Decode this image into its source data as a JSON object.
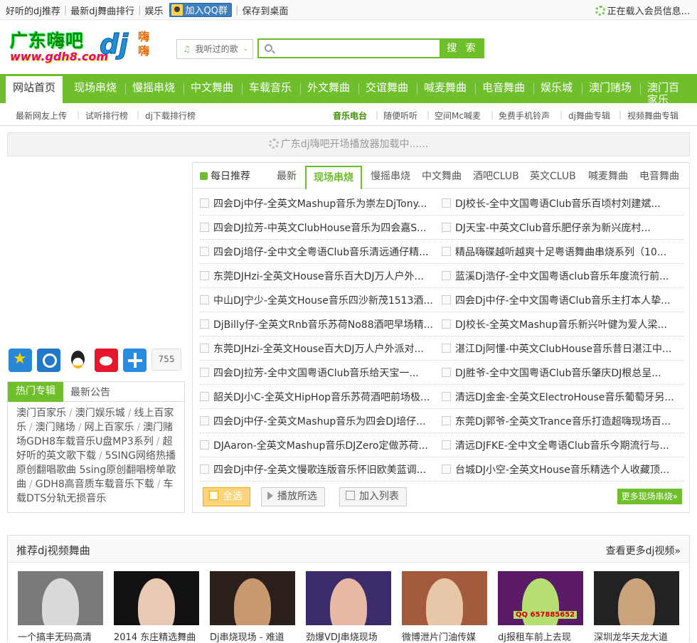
{
  "topbar": {
    "links": [
      "好听的dj推荐",
      "最新dj舞曲排行",
      "娱乐"
    ],
    "qq_group": "加入QQ群",
    "save_desktop": "保存到桌面",
    "member_loading": "正在载入会员信息..."
  },
  "logo": {
    "title": "广东嗨吧",
    "url": "www.gdh8.com",
    "dj": "dj",
    "hihi": "嗨嗨"
  },
  "search": {
    "history_label": "我听过的歌",
    "button_label": "搜 索",
    "value": ""
  },
  "nav": {
    "items": [
      "网站首页",
      "现场串烧",
      "慢摇串烧",
      "中文舞曲",
      "车载音乐",
      "外文舞曲",
      "交谊舞曲",
      "喊麦舞曲",
      "电音舞曲",
      "娱乐城",
      "澳门赌场",
      "澳门百家乐"
    ]
  },
  "subnav": {
    "left": [
      "最新网友上传",
      "试听排行榜",
      "dj下载排行榜"
    ],
    "right": [
      "音乐电台",
      "随便听听",
      "空间Mc喊麦",
      "免费手机铃声",
      "dj舞曲专辑",
      "视频舞曲专辑"
    ]
  },
  "player_loading": "广东dj嗨吧开场播放器加载中......",
  "share": {
    "count": "755",
    "icons": [
      "qzone-star-icon",
      "tencent-weibo-icon",
      "qq-icon",
      "sina-weibo-icon",
      "more-share-icon"
    ]
  },
  "hot_albums": {
    "tab_active": "热门专辑",
    "tab_other": "最新公告",
    "items": [
      "澳门百家乐",
      "澳门娱乐城",
      "线上百家乐",
      "澳门赌场",
      "网上百家乐",
      "澳门赌场GDH8车载音乐U盘MP3系列",
      "超好听的英文歌下载",
      "5SING网络热播原创翻唱歌曲 5sing原创翻唱榜单歌曲",
      "GDH8高音质车载音乐下载",
      "车载DTS分轨无损音乐"
    ]
  },
  "tabs": {
    "daily": "每日推荐",
    "items": [
      "最新",
      "现场串烧",
      "慢摇串烧",
      "中文舞曲",
      "酒吧CLUB",
      "英文CLUB",
      "喊麦舞曲",
      "电音舞曲"
    ],
    "active_index": 1
  },
  "songs": [
    [
      "四会Dj中仔-全英文Mashup音乐为崇左DjTony...",
      "DJ校长-全中文国粤语Club音乐百顷村刘建斌..."
    ],
    [
      "四会DJ拉芳-中英文ClubHouse音乐为四会嘉S...",
      "DJ天宝-中英文Club音乐肥仔亲为新兴庞村..."
    ],
    [
      "四会Dj培仔-全中文全粤语Club音乐清远通仔精...",
      "精品嗨碟越听越爽十足粤语舞曲串烧系列（10..."
    ],
    [
      "东莞DJHzi-全英文House音乐百大DJ万人户外...",
      "蓝溪Dj浩仔-全中文国粤语club音乐年度流行前..."
    ],
    [
      "中山DJ宁少-全英文House音乐四沙新茂1513酒...",
      "四会Dj中仔-全中文国粤语Club音乐主打本人挚..."
    ],
    [
      "DjBilly仔-全英文Rnb音乐苏荷No88酒吧早场精...",
      "DJ校长-全英文Mashup音乐新兴叶健为爱人梁..."
    ],
    [
      "东莞DJHzi-全英文House百大DJ万人户外派对...",
      "湛江Dj阿懂-中英文ClubHouse音乐昔日湛江中..."
    ],
    [
      "四会DJ拉芳-全中文国粤语Club音乐给天宝一...",
      "DJ胜爷-全中文国粤语Club音乐肇庆DJ根总呈..."
    ],
    [
      "韶关DJ小C-全英文HipHop音乐苏荷酒吧前场极...",
      "清远DJ金金-全英文ElectroHouse音乐葡萄牙另..."
    ],
    [
      "四会Dj中仔-全英文Mashup音乐为四会DJ培仔...",
      "东莞Dj郭爷-全英文Trance音乐打造超嗨现场百..."
    ],
    [
      "DJAaron-全英文Mashup音乐DJZero定做苏荷...",
      "清远DJFKE-全中文全粤语Club音乐今期流行与..."
    ],
    [
      "四会Dj中仔-全英文慢歌连版音乐怀旧欧美蓝调...",
      "台城DJ小空-全英文House音乐精选个人收藏顶..."
    ]
  ],
  "actions": {
    "select_all": "全选",
    "play_selected": "播放所选",
    "add_list": "加入列表",
    "more": "更多现场串烧»"
  },
  "video": {
    "title": "推荐dj视频舞曲",
    "more": "查看更多dj视频»",
    "items": [
      {
        "caption": "一个搞丰无码高清",
        "colors": [
          "#7a7a7a",
          "#d9d9d9"
        ]
      },
      {
        "caption": "2014 东庄精选舞曲",
        "colors": [
          "#111111",
          "#e8c9b6"
        ]
      },
      {
        "caption": "Dj串烧现场 - 难道",
        "colors": [
          "#2a1f1a",
          "#c9986e"
        ]
      },
      {
        "caption": "劲爆VDJ串烧现场",
        "colors": [
          "#3b2b6b",
          "#e7b9a4"
        ]
      },
      {
        "caption": "微博泄片门油传媒",
        "colors": [
          "#a35a3d",
          "#e8c6a8"
        ]
      },
      {
        "caption": "dj报租车前上去现",
        "colors": [
          "#5a1a66",
          "#b6df73"
        ]
      },
      {
        "caption": "深圳龙华天龙大道",
        "colors": [
          "#222222",
          "#caa27c"
        ]
      }
    ],
    "badge": "QQ 657885652"
  },
  "colors": {
    "brand_green": "#6fbf2c",
    "link_blue": "#1f8fd6"
  }
}
